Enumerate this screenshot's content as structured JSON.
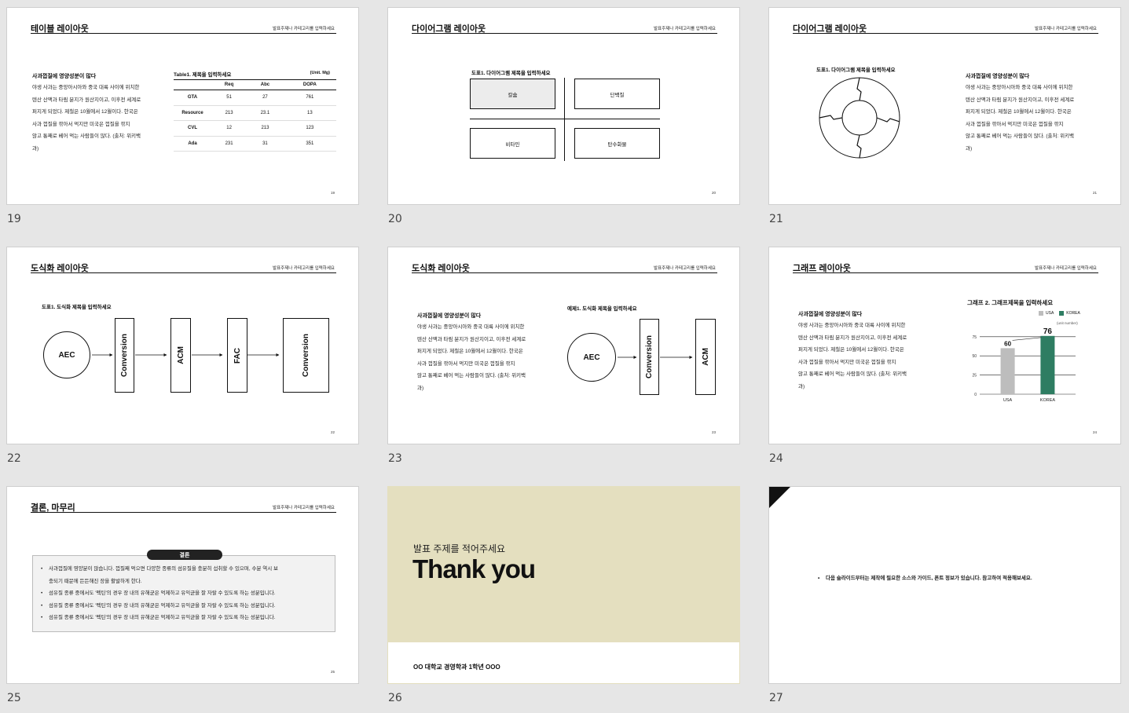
{
  "common": {
    "subtitle": "발표주제나 카테고리를 입력하세요",
    "paragraph_title": "사과껍질에 영양성분이 많다",
    "paragraph_lines": [
      "야생 사과는 중앙아시아와 중국 대륙 사이에 위치한",
      "텐산 산맥과 타림 분지가 원산지이고, 이후전 세계로",
      "퍼지게 되었다. 제철은 10월에서 12월이다. 한국은",
      "사과 껍질을 깎아서 먹지만 미국은 껍질을 깎지",
      "않고 통째로 베어 먹는 사람들이 많다. (출처: 위키백",
      "과)"
    ]
  },
  "slides": [
    {
      "number": "19",
      "page": "19",
      "title": "테이블 레이아웃",
      "table": {
        "caption": "Table1. 제목을 입력하세요",
        "unit": "(Unit. Mg)",
        "headers": [
          "",
          "Req",
          "Abc",
          "DOPA"
        ],
        "rows": [
          [
            "GTA",
            "51",
            "27",
            "761"
          ],
          [
            "Resource",
            "213",
            "23.1",
            "13"
          ],
          [
            "CVL",
            "12",
            "213",
            "123"
          ],
          [
            "Ada",
            "231",
            "31",
            "351"
          ]
        ]
      }
    },
    {
      "number": "20",
      "page": "20",
      "title": "다이어그램 레이아웃",
      "caption": "도표1. 다이어그램 제목을 입력하세요",
      "boxes": [
        "칼슘",
        "단백질",
        "비타민",
        "탄수화물"
      ]
    },
    {
      "number": "21",
      "page": "21",
      "title": "다이어그램 레이아웃",
      "caption": "도표1. 다이어그램 제목을 입력하세요"
    },
    {
      "number": "22",
      "page": "22",
      "title": "도식화 레이아웃",
      "caption": "도표1. 도식화 제목을 입력하세요",
      "start": "AEC",
      "steps": [
        "Conversion",
        "ACM",
        "FAC",
        "Conversion"
      ]
    },
    {
      "number": "23",
      "page": "23",
      "title": "도식화 레이아웃",
      "caption": "예제1. 도식화 제목을 입력하세요",
      "start": "AEC",
      "steps": [
        "Conversion",
        "ACM"
      ]
    },
    {
      "number": "24",
      "page": "24",
      "title": "그래프 레이아웃",
      "chart_title": "그래프 2. 그래프제목을 입력하세요",
      "unit_label": "(unit number)"
    },
    {
      "number": "25",
      "page": "25",
      "title": "결론, 마무리",
      "badge": "결론",
      "bullets": [
        "사과껍질에 영양분이 많습니다. 껍질째 먹으면 다양한 종류의 섬유질을 충분히 섭취할 수 있으며, 수분 역시 보",
        "충되기 때문에 든든해진 장을 활발하게 한다.",
        "섬유질 종류 중에서도 '펙틴'의 경우 장 내의 유해균은 억제하고 유익균을 잘 자랄 수 있도록 하는 성분입니다.",
        "섬유질 종류 중에서도 '펙틴'의 경우 장 내의 유해균은 억제하고 유익균을 잘 자랄 수 있도록 하는 성분입니다.",
        "섬유질 종류 중에서도 '펙틴'의 경우 장 내의 유해균은 억제하고 유익균을 잘 자랄 수 있도록 하는 성분입니다."
      ]
    },
    {
      "number": "26",
      "topic": "발표 주제를 적어주세요",
      "thanks": "Thank you",
      "author": "OO 대학교 경영학과 1학년 OOO",
      "band_color": "#e4dfbf"
    },
    {
      "number": "27",
      "note": "다음 슬라이드부터는 제작에 필요한 소스와 가이드, 폰트 정보가 있습니다. 참고하여 적용해보세요."
    }
  ],
  "chart_data": {
    "type": "bar",
    "categories": [
      "USA",
      "KOREA"
    ],
    "values": [
      60,
      76
    ],
    "legend": [
      "USA",
      "KOREA"
    ],
    "colors": [
      "#bdbdbd",
      "#2e7d62"
    ],
    "yticks": [
      0,
      25,
      50,
      75
    ],
    "ylim": [
      0,
      85
    ],
    "legend_position": "top-right",
    "grid": true
  }
}
